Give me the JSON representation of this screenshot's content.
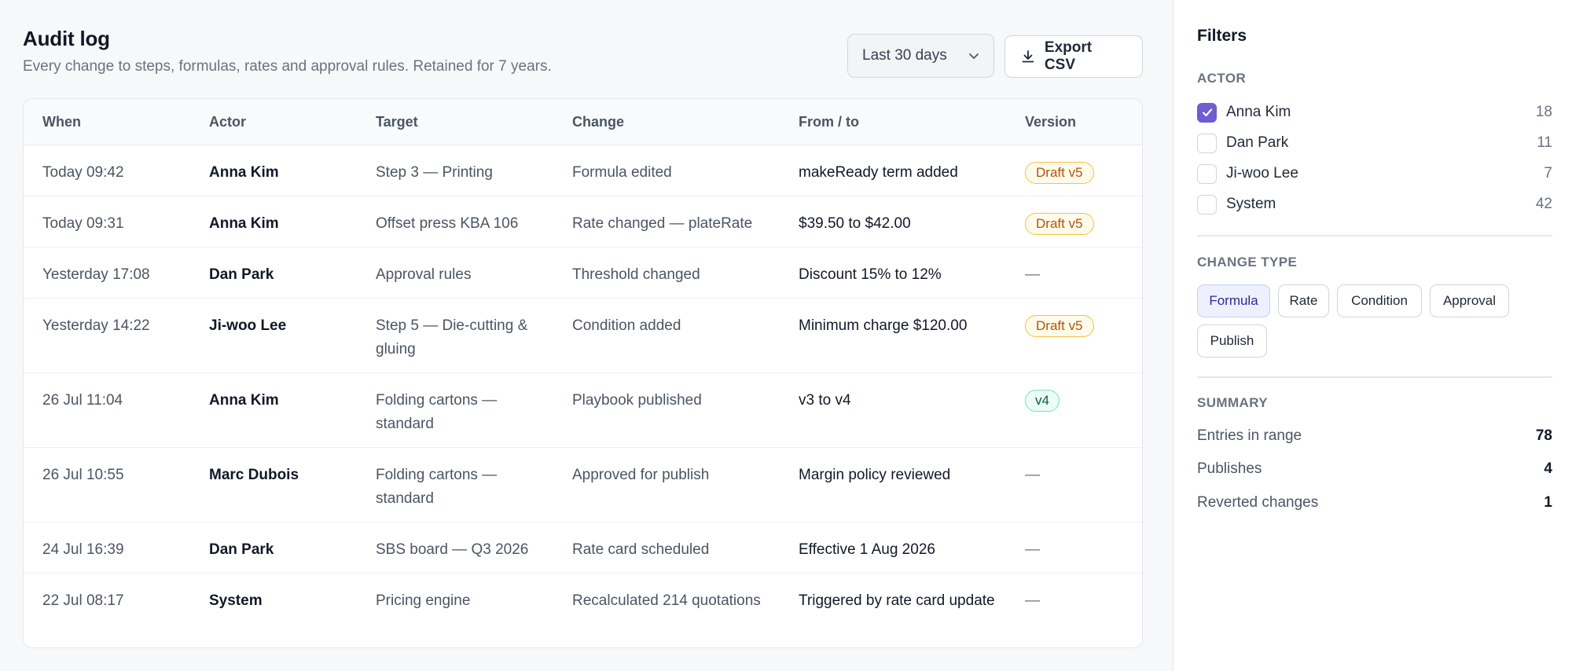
{
  "header": {
    "title": "Audit log",
    "subtitle": "Every change to steps, formulas, rates and approval rules. Retained for 7 years.",
    "range_value": "Last 30 days",
    "export_label": "Export CSV"
  },
  "table": {
    "columns": [
      "When",
      "Actor",
      "Target",
      "Change",
      "From / to",
      "Version"
    ],
    "rows": [
      {
        "when": "Today 09:42",
        "actor": "Anna Kim",
        "target": "Step 3 — Printing",
        "change": "Formula edited",
        "fromto": "makeReady term added",
        "version": "Draft v5",
        "version_kind": "draft"
      },
      {
        "when": "Today 09:31",
        "actor": "Anna Kim",
        "target": "Offset press KBA 106",
        "change": "Rate changed — plateRate",
        "fromto": "$39.50 to $42.00",
        "version": "Draft v5",
        "version_kind": "draft"
      },
      {
        "when": "Yesterday 17:08",
        "actor": "Dan Park",
        "target": "Approval rules",
        "change": "Threshold changed",
        "fromto": "Discount 15% to 12%",
        "version": "—",
        "version_kind": "none"
      },
      {
        "when": "Yesterday 14:22",
        "actor": "Ji-woo Lee",
        "target": "Step 5 — Die-cutting & gluing",
        "change": "Condition added",
        "fromto": "Minimum charge $120.00",
        "version": "Draft v5",
        "version_kind": "draft"
      },
      {
        "when": "26 Jul 11:04",
        "actor": "Anna Kim",
        "target": "Folding cartons — standard",
        "change": "Playbook published",
        "fromto": "v3 to v4",
        "version": "v4",
        "version_kind": "published"
      },
      {
        "when": "26 Jul 10:55",
        "actor": "Marc Dubois",
        "target": "Folding cartons — standard",
        "change": "Approved for publish",
        "fromto": "Margin policy reviewed",
        "version": "—",
        "version_kind": "none"
      },
      {
        "when": "24 Jul 16:39",
        "actor": "Dan Park",
        "target": "SBS board — Q3 2026",
        "change": "Rate card scheduled",
        "fromto": "Effective 1 Aug 2026",
        "version": "—",
        "version_kind": "none"
      },
      {
        "when": "22 Jul 08:17",
        "actor": "System",
        "target": "Pricing engine",
        "change": "Recalculated 214 quotations",
        "fromto": "Triggered by rate card update",
        "version": "—",
        "version_kind": "none"
      }
    ]
  },
  "filters": {
    "title": "Filters",
    "actor_heading": "ACTOR",
    "actors": [
      {
        "name": "Anna Kim",
        "count": "18",
        "checked": true
      },
      {
        "name": "Dan Park",
        "count": "11",
        "checked": false
      },
      {
        "name": "Ji-woo Lee",
        "count": "7",
        "checked": false
      },
      {
        "name": "System",
        "count": "42",
        "checked": false
      }
    ],
    "change_type_heading": "CHANGE TYPE",
    "change_types": [
      {
        "label": "Formula",
        "active": true
      },
      {
        "label": "Rate",
        "active": false
      },
      {
        "label": "Condition",
        "active": false
      },
      {
        "label": "Approval",
        "active": false
      },
      {
        "label": "Publish",
        "active": false
      }
    ],
    "summary_heading": "SUMMARY",
    "summary": [
      {
        "label": "Entries in range",
        "value": "78"
      },
      {
        "label": "Publishes",
        "value": "4"
      },
      {
        "label": "Reverted changes",
        "value": "1"
      }
    ]
  },
  "colors": {
    "accent": "#6d5dd3",
    "draft_badge": "#b45309",
    "published_badge": "#065f46"
  }
}
